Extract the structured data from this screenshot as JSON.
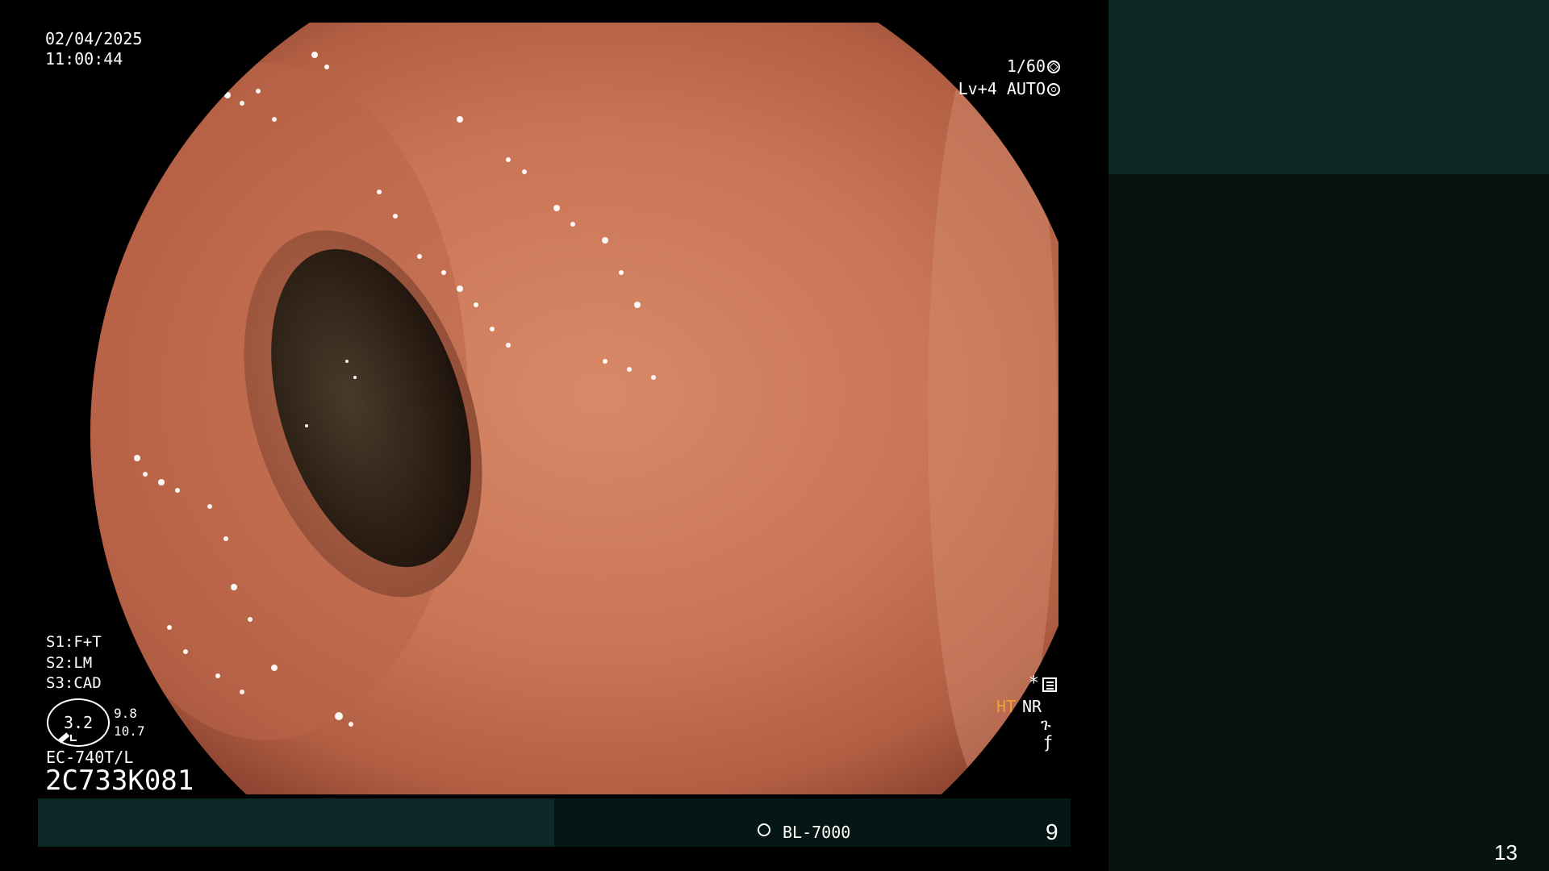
{
  "osd": {
    "date": "02/04/2025",
    "time": "11:00:44",
    "shutter": "1/60",
    "level": "Lv+4",
    "auto": "AUTO",
    "s1": "S1:F+T",
    "s2": "S2:LM",
    "s3": "S3:CAD",
    "zoom_main": "3.2",
    "zoom_a": "9.8",
    "zoom_b": "10.7",
    "scope_model": "EC-740T/L",
    "scope_serial": "2C733K081",
    "star": "*",
    "ht": "HT",
    "nr": "NR",
    "glyph1": "ጉ",
    "glyph2": "ƒ",
    "lamp_label": "BL-7000",
    "bottom_number": "9"
  },
  "sidebar": {
    "page_number": "13"
  },
  "colors": {
    "background": "#000000",
    "tissue": "#c86e4e",
    "lumen": "#2d2116",
    "ht_accent": "#f0a030",
    "panel_dark": "#061614",
    "panel_teal": "#0e2826"
  },
  "icons": {
    "shutter": "shutter-icon",
    "auto": "auto-icon",
    "menu": "menu-icon",
    "lamp": "lamp-icon"
  }
}
